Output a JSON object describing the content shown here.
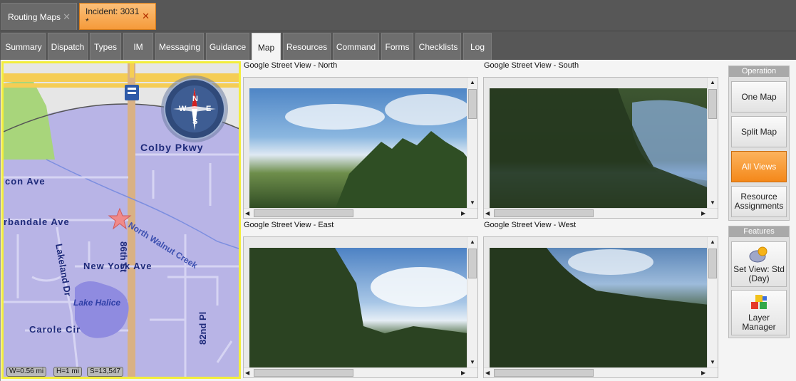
{
  "doc_tabs": [
    {
      "label": "Routing Maps"
    },
    {
      "label": "Incident: 3031 *"
    }
  ],
  "menu_tabs": [
    "Summary",
    "Dispatch",
    "Types",
    "IM",
    "Messaging",
    "Guidance",
    "Map",
    "Resources",
    "Command",
    "Forms",
    "Checklists",
    "Log"
  ],
  "active_menu_tab": "Map",
  "map": {
    "compass": {
      "n": "N",
      "e": "E",
      "s": "S",
      "w": "W"
    },
    "labels": {
      "colby": "Colby Pkwy",
      "con_ave": "con Ave",
      "urbandale": "rbandale Ave",
      "walnut_creek": "North Walnut Creek",
      "st86": "86th St",
      "lakeland": "Lakeland Dr",
      "new_york": "New York Ave",
      "lake_halice": "Lake Halice",
      "carole": "Carole Cir",
      "pl82": "82nd Pl"
    },
    "scale": {
      "width": "W=0.56 mi",
      "height": "H=1 mi",
      "scale": "S=13,547"
    }
  },
  "street_views": {
    "north": "Google Street View - North",
    "south": "Google Street View - South",
    "east": "Google Street View - East",
    "west": "Google Street View - West"
  },
  "operation": {
    "header": "Operation",
    "buttons": [
      "One Map",
      "Split Map",
      "All Views",
      "Resource Assignments"
    ],
    "active": "All Views"
  },
  "features": {
    "header": "Features",
    "set_view": "Set View: Std (Day)",
    "layer_manager": "Layer Manager"
  },
  "colors": {
    "active_tab": "#f59a3a",
    "map_border": "#f3ee3c",
    "map_fill": "#b8b4e6"
  }
}
